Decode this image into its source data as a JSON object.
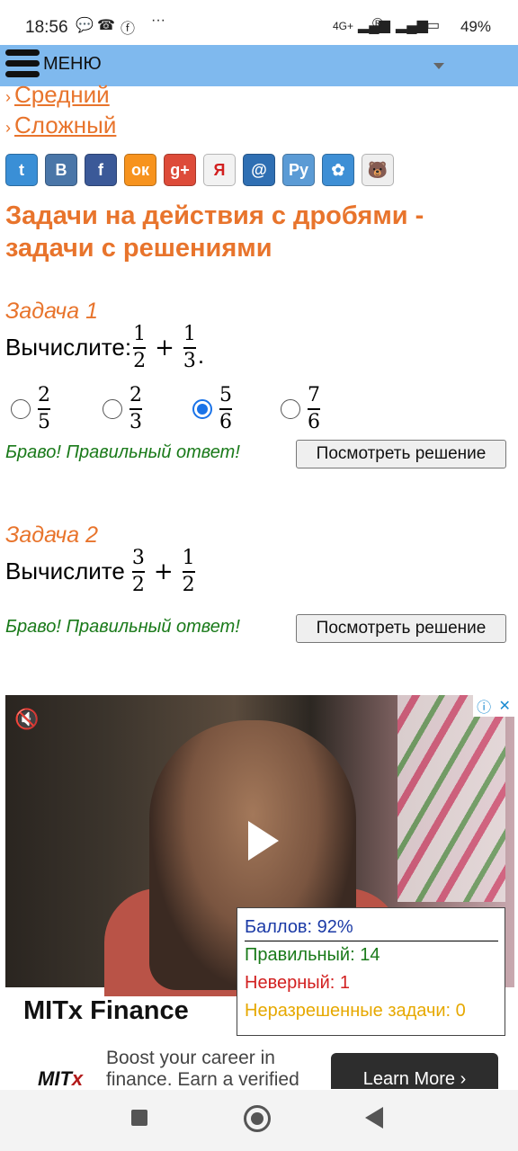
{
  "status_bar": {
    "time": "18:56",
    "network": "4G+",
    "battery": "49%"
  },
  "menu": {
    "label": "МЕНЮ"
  },
  "levels": [
    "Средний",
    "Сложный"
  ],
  "social": [
    {
      "name": "twitter-icon",
      "glyph": "t",
      "color": "#3a8fd6"
    },
    {
      "name": "vk-icon",
      "glyph": "B",
      "color": "#4a76a8"
    },
    {
      "name": "facebook-icon",
      "glyph": "f",
      "color": "#3b5998"
    },
    {
      "name": "odnoklassniki-icon",
      "glyph": "ок",
      "color": "#f7931e"
    },
    {
      "name": "google-plus-icon",
      "glyph": "g+",
      "color": "#dd4b39"
    },
    {
      "name": "yandex-icon",
      "glyph": "Я",
      "color": "#f2f2f2"
    },
    {
      "name": "mail-ru-icon",
      "glyph": "@",
      "color": "#2f6fb3"
    },
    {
      "name": "liveinternet-icon",
      "glyph": "Ру",
      "color": "#5b9bd5"
    },
    {
      "name": "settings-icon",
      "glyph": "✿",
      "color": "#3e8fd5"
    },
    {
      "name": "mascot-icon",
      "glyph": "🐻",
      "color": "#eeeeee"
    }
  ],
  "page_title": "Задачи на действия с дробями - задачи с решениями",
  "tasks": [
    {
      "title": "Задача 1",
      "prompt": "Вычислите:",
      "expr": [
        {
          "n": "1",
          "d": "2"
        },
        {
          "n": "1",
          "d": "3"
        }
      ],
      "operator": "+",
      "trail": ".",
      "answers": [
        {
          "n": "2",
          "d": "5"
        },
        {
          "n": "2",
          "d": "3"
        },
        {
          "n": "5",
          "d": "6"
        },
        {
          "n": "7",
          "d": "6"
        }
      ],
      "selected_index": 2,
      "feedback": "Браво! Правильный ответ!",
      "button": "Посмотреть решение"
    },
    {
      "title": "Задача 2",
      "prompt": "Вычислите",
      "expr": [
        {
          "n": "3",
          "d": "2"
        },
        {
          "n": "1",
          "d": "2"
        }
      ],
      "operator": "+",
      "feedback": "Браво! Правильный ответ!",
      "button": "Посмотреть решение"
    }
  ],
  "ad": {
    "brand": "MITx Finance",
    "logo_main": "MIT",
    "logo_x": "x",
    "copy_line1": "Boost your career in",
    "copy_line2": "finance. Earn a verified",
    "cta": "Learn More ›"
  },
  "score": {
    "percent_label": "Баллов: 92%",
    "correct_label": "Правильный: 14",
    "wrong_label": "Неверный: 1",
    "unsolved_label": "Неразрешенные задачи: 0",
    "colors": {
      "percent": "#1b3aa6",
      "correct": "#1a7a1a",
      "wrong": "#d22020",
      "unsolved": "#e6a800"
    }
  }
}
